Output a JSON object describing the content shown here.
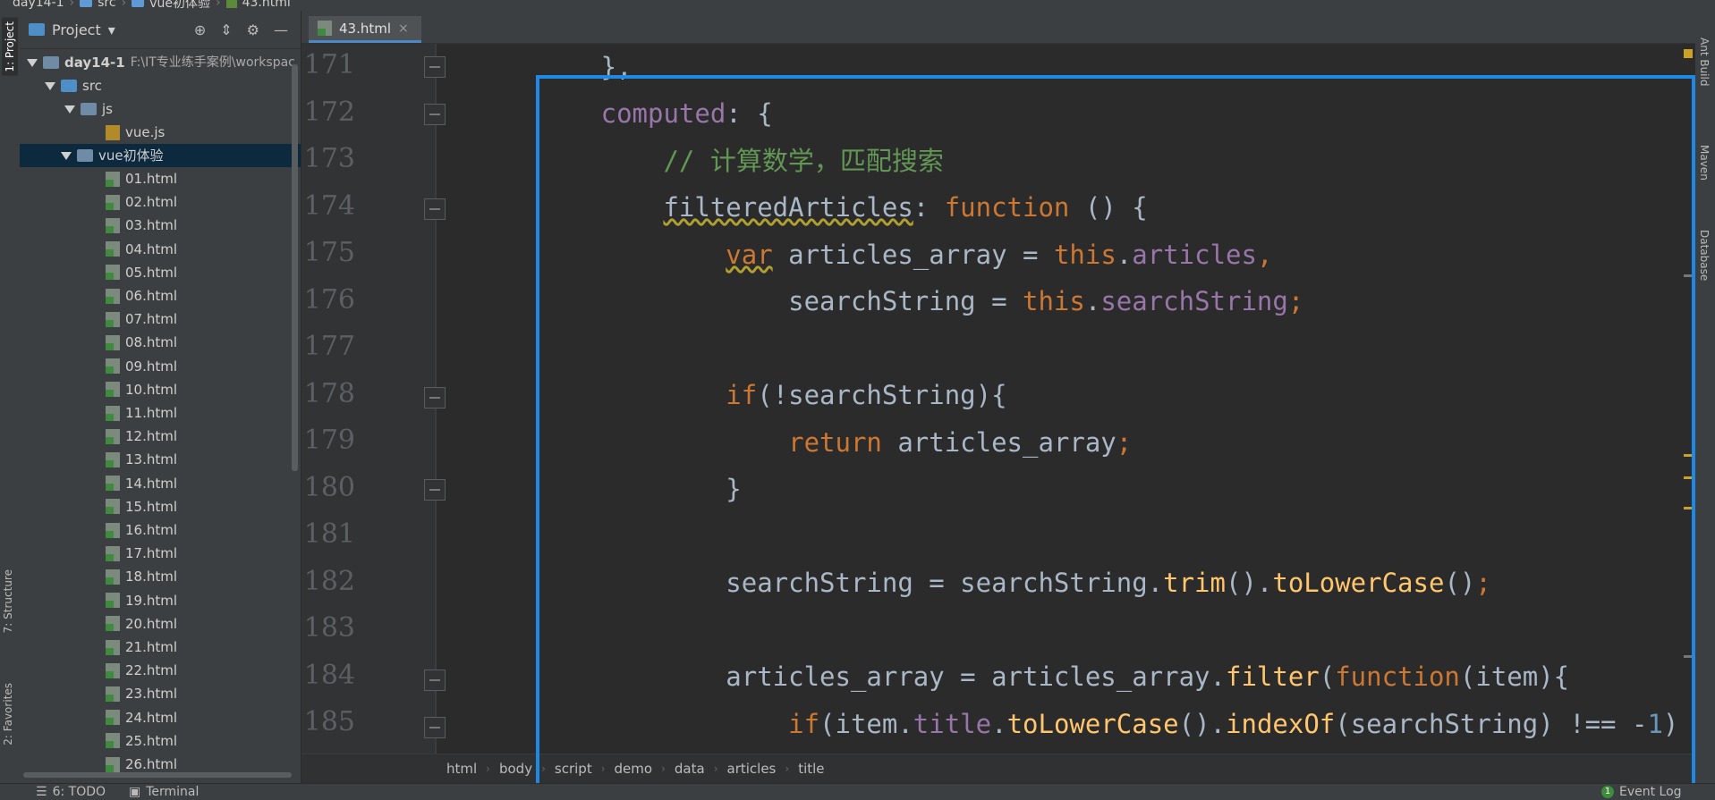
{
  "breadcrumb_top": [
    "day14-1",
    "src",
    "vue初体验",
    "43.html"
  ],
  "left_tabs": [
    "1: Project",
    "7: Structure",
    "2: Favorites"
  ],
  "right_tabs": [
    "Ant Build",
    "Maven",
    "Database"
  ],
  "project": {
    "title": "Project",
    "root_label": "day14-1",
    "root_path": "F:\\IT专业练手案例\\workspac",
    "src": "src",
    "js_folder": "js",
    "js_file": "vue.js",
    "vue_folder": "vue初体验",
    "files": [
      "01.html",
      "02.html",
      "03.html",
      "04.html",
      "05.html",
      "06.html",
      "07.html",
      "08.html",
      "09.html",
      "10.html",
      "11.html",
      "12.html",
      "13.html",
      "14.html",
      "15.html",
      "16.html",
      "17.html",
      "18.html",
      "19.html",
      "20.html",
      "21.html",
      "22.html",
      "23.html",
      "24.html",
      "25.html",
      "26.html"
    ]
  },
  "editor": {
    "tab_label": "43.html",
    "line_numbers": [
      "171",
      "172",
      "173",
      "174",
      "175",
      "176",
      "177",
      "178",
      "179",
      "180",
      "181",
      "182",
      "183",
      "184",
      "185"
    ],
    "breadcrumb": [
      "html",
      "body",
      "script",
      "demo",
      "data",
      "articles",
      "title"
    ]
  },
  "status": {
    "todo": "6: TODO",
    "terminal": "Terminal",
    "event_log": "Event Log",
    "event_count": "1"
  },
  "colors": {
    "highlight_border": "#1e88e5",
    "keyword": "#cc7832",
    "property": "#9876aa",
    "function_call": "#ffc66d",
    "comment": "#629755"
  }
}
